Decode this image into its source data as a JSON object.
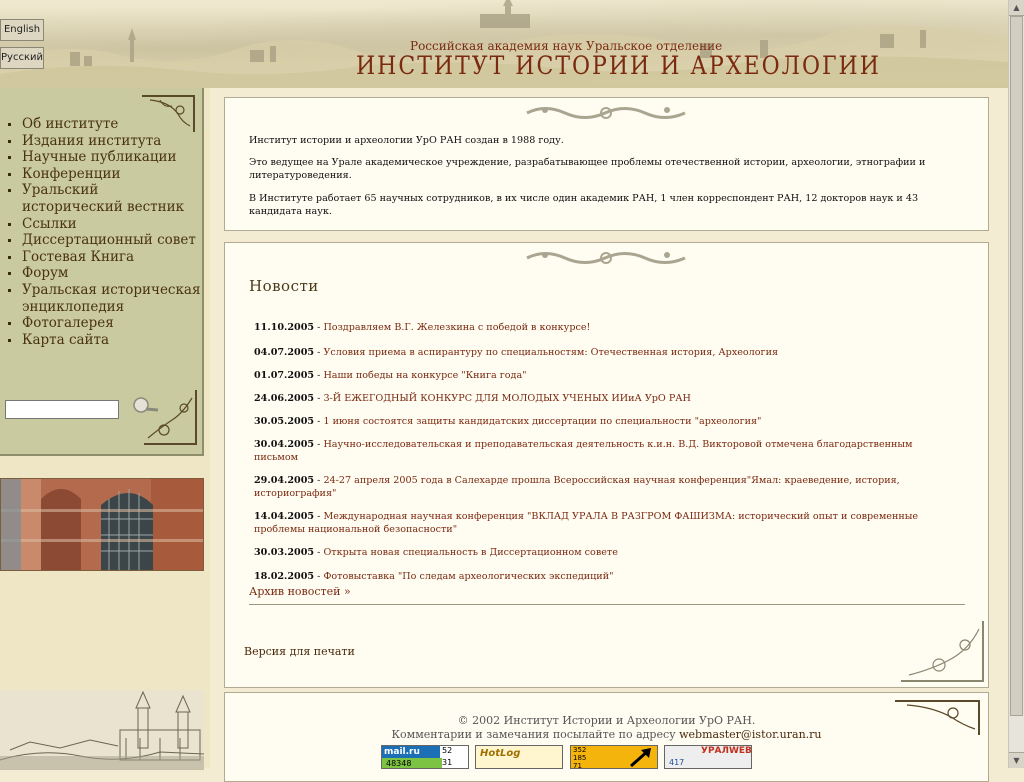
{
  "header": {
    "subtitle": "Российская академия наук Уральское отделение",
    "title": "ИНСТИТУТ ИСТОРИИ И АРХЕОЛОГИИ",
    "lang_en": "English",
    "lang_ru": "Русский"
  },
  "nav": {
    "items": [
      {
        "label": "Об институте"
      },
      {
        "label": "Издания института"
      },
      {
        "label": "Научные публикации"
      },
      {
        "label": "Конференции"
      },
      {
        "label": "Уральский исторический вестник"
      },
      {
        "label": "Ссылки"
      },
      {
        "label": "Диссертационный совет"
      },
      {
        "label": "Гостевая Книга"
      },
      {
        "label": "Форум"
      },
      {
        "label": "Уральская историческая энциклопедия"
      },
      {
        "label": "Фотогалерея"
      },
      {
        "label": "Карта сайта"
      }
    ]
  },
  "search": {
    "value": ""
  },
  "intro": {
    "p1": "Институт истории и археологии УрО РАН создан в 1988 году.",
    "p2": "Это ведущее на Урале академическое учреждение, разрабатывающее проблемы отечественной истории, археологии, этнографии и литературоведения.",
    "p3": "В Институте работает 65 научных сотрудников, в их числе один академик РАН, 1 член корреспондент РАН, 12 докторов наук и 43 кандидата наук."
  },
  "news": {
    "title": "Новости",
    "separator": " - ",
    "items": [
      {
        "date": "11.10.2005",
        "text": "Поздравляем В.Г. Железкина с победой в конкурсе!"
      },
      {
        "date": "04.07.2005",
        "text": "Условия приема в аспирантуру по специальностям: Отечественная история, Археология"
      },
      {
        "date": "01.07.2005",
        "text": "Наши победы на конкурсе \"Книга года\""
      },
      {
        "date": "24.06.2005",
        "text": "3-Й ЕЖЕГОДНЫЙ КОНКУРС ДЛЯ МОЛОДЫХ УЧЕНЫХ ИИиА УрО РАН"
      },
      {
        "date": "30.05.2005",
        "text": "1 июня состоятся защиты кандидатских диссертации по специальности \"археология\""
      },
      {
        "date": "30.04.2005",
        "text": "Научно-исследовательская и преподавательская деятельность к.и.н. В.Д. Викторовой отмечена благодарственным письмом"
      },
      {
        "date": "29.04.2005",
        "text": "24-27 апреля 2005 года в Салехарде прошла Всероссийская научная конференция\"Ямал: краеведение, история, историография\""
      },
      {
        "date": "14.04.2005",
        "text": "Международная научная конференция \"ВКЛАД УРАЛА В РАЗГРОМ ФАШИЗМА: исторический опыт и современные проблемы национальной безопасности\""
      },
      {
        "date": "30.03.2005",
        "text": "Открыта новая специальность в Диссертационном совете"
      },
      {
        "date": "18.02.2005",
        "text": "Фотовыставка \"По следам археологических экспедиций\""
      }
    ],
    "archive": "Архив новостей »"
  },
  "print_version": "Версия для печати",
  "footer": {
    "copyright": "© 2002 Институт Истории и Археологии УрО РАН.",
    "comments_prefix": "Комментарии и замечания посылайте по адресу ",
    "email": "webmaster@istor.uran.ru"
  },
  "counters": {
    "mail": {
      "logo": "mail.ru",
      "n1": "52",
      "n2": "48348",
      "n3": "31"
    },
    "hotlog": {
      "logo": "HotLog"
    },
    "third": {
      "n1": "352",
      "n2": "185",
      "n3": "71"
    },
    "uralweb": {
      "logo": "УРАЛWEB",
      "n1": "417"
    }
  },
  "colors": {
    "accent": "#7a2a10",
    "nav_bg": "#c9ca9f",
    "panel_bg": "#fffcf2",
    "page_bg": "#f3ecd2"
  }
}
